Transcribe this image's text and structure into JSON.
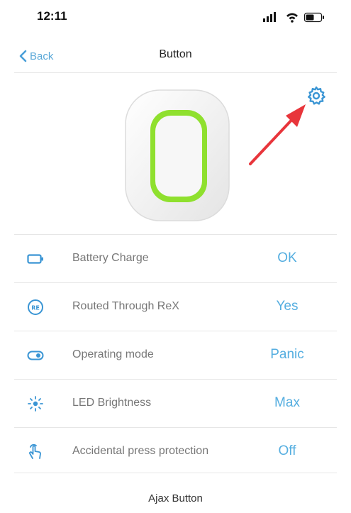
{
  "status_bar": {
    "time": "12:11",
    "icons": [
      "signal-icon",
      "wifi-icon",
      "battery-icon"
    ]
  },
  "nav": {
    "back_label": "Back",
    "title": "Button"
  },
  "hero": {
    "device": "button-device-image",
    "settings_icon": "gear-icon",
    "annotation": "red-arrow"
  },
  "rows": [
    {
      "icon": "battery-outline-icon",
      "label": "Battery Charge",
      "value": "OK"
    },
    {
      "icon": "rex-badge-icon",
      "label": "Routed Through ReX",
      "value": "Yes"
    },
    {
      "icon": "toggle-icon",
      "label": "Operating mode",
      "value": "Panic"
    },
    {
      "icon": "brightness-icon",
      "label": "LED Brightness",
      "value": "Max"
    },
    {
      "icon": "hand-tap-icon",
      "label": "Accidental press protection",
      "value": "Off"
    }
  ],
  "footer": {
    "label": "Ajax Button"
  },
  "colors": {
    "accent": "#55aee0",
    "device_ring": "#7ed321",
    "arrow": "#e8353b"
  }
}
